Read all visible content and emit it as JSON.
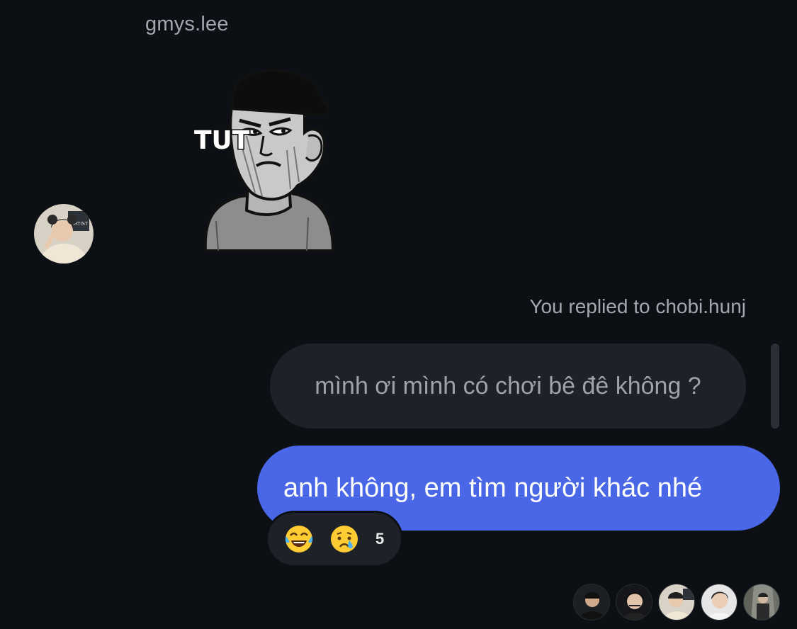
{
  "conversation": {
    "sender_name": "gmys.lee",
    "sticker": {
      "text": "TUT",
      "description": "sticker-man-frowning"
    },
    "reply_context": "You replied to chobi.hunj",
    "quoted_message": "mình ơi mình có chơi bê đê không ?",
    "my_message": "anh không, em tìm người khác nhé",
    "reactions": {
      "emojis": [
        "laughing-tears",
        "crying"
      ],
      "count": "5"
    },
    "seen_by_count": 5
  },
  "colors": {
    "background": "#0c0f14",
    "my_bubble": "#4967e6",
    "quoted_bubble": "#1e2127",
    "muted_text": "#a3a7ae"
  }
}
